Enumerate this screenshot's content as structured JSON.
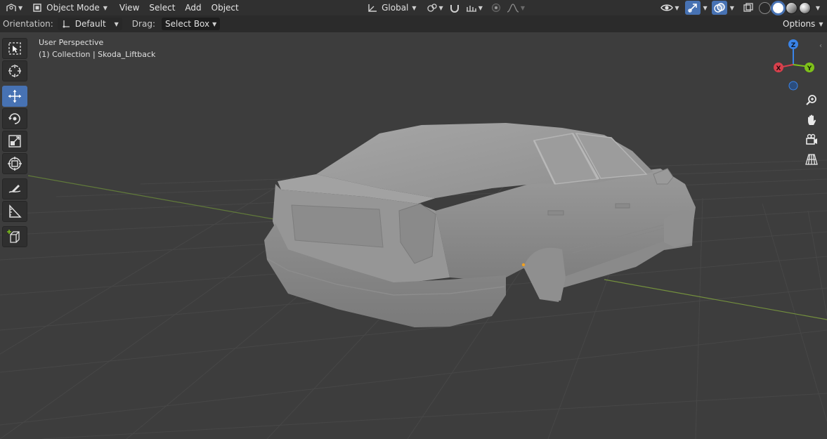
{
  "header": {
    "editor_type_icon": "3d-viewport-icon",
    "mode": "Object Mode",
    "menus": [
      "View",
      "Select",
      "Add",
      "Object"
    ],
    "transform_orientation": "Global",
    "shading_modes": [
      "wireframe",
      "solid",
      "material-preview",
      "rendered"
    ],
    "active_shading": "solid"
  },
  "toolheader": {
    "orientation_label": "Orientation:",
    "orientation_value": "Default",
    "drag_label": "Drag:",
    "drag_value": "Select Box",
    "options_label": "Options"
  },
  "viewport": {
    "perspective": "User Perspective",
    "collection_info": "(1) Collection | Skoda_Liftback",
    "gizmo_axes": [
      "Z",
      "X",
      "Y"
    ],
    "colors": {
      "x_axis": "#d8404c",
      "y_axis": "#7ec11a",
      "z_axis": "#3a84e8",
      "active_tool": "#4772b3",
      "background": "#3d3d3d"
    }
  },
  "toolbar": {
    "tools": [
      "select-box",
      "cursor",
      "move",
      "rotate",
      "scale",
      "transform",
      "annotate",
      "measure",
      "add-cube"
    ],
    "active_tool": "move"
  },
  "navigation": {
    "buttons": [
      "zoom",
      "pan",
      "camera-view",
      "toggle-perspective"
    ]
  }
}
